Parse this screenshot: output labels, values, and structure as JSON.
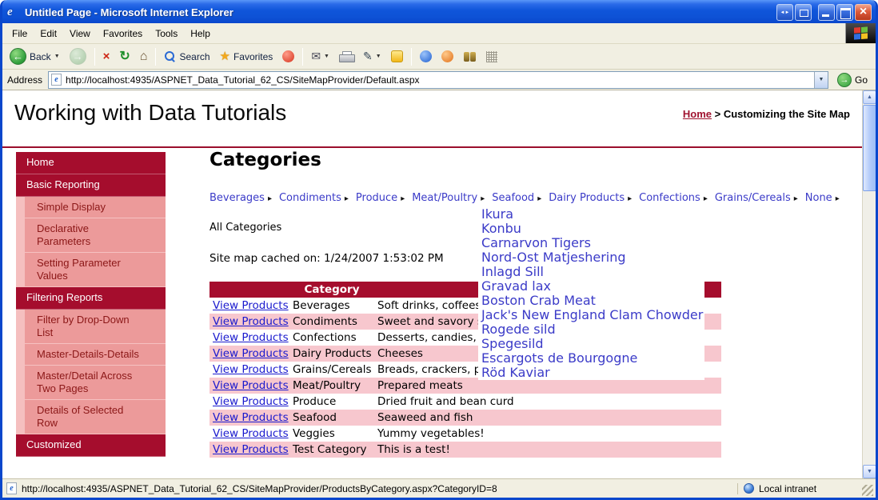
{
  "titlebar": {
    "title": "Untitled Page - Microsoft Internet Explorer"
  },
  "menubar": {
    "items": [
      "File",
      "Edit",
      "View",
      "Favorites",
      "Tools",
      "Help"
    ]
  },
  "toolbar": {
    "back": "Back",
    "search": "Search",
    "favorites": "Favorites"
  },
  "addressbar": {
    "label": "Address",
    "url": "http://localhost:4935/ASPNET_Data_Tutorial_62_CS/SiteMapProvider/Default.aspx",
    "go": "Go"
  },
  "header": {
    "title": "Working with Data Tutorials",
    "breadcrumb": {
      "home": "Home",
      "separator": " > ",
      "current": "Customizing the Site Map"
    }
  },
  "sidebar": {
    "items": [
      {
        "label": "Home"
      },
      {
        "label": "Basic Reporting"
      },
      {
        "label": "Simple Display"
      },
      {
        "label": "Declarative Parameters"
      },
      {
        "label": "Setting Parameter Values"
      },
      {
        "label": "Filtering Reports"
      },
      {
        "label": "Filter by Drop-Down List"
      },
      {
        "label": "Master-Details-Details"
      },
      {
        "label": "Master/Detail Across Two Pages"
      },
      {
        "label": "Details of Selected Row"
      },
      {
        "label": "Customized"
      }
    ]
  },
  "main": {
    "heading": "Categories",
    "menu": {
      "items": [
        "Beverages",
        "Condiments",
        "Produce",
        "Meat/Poultry",
        "Seafood",
        "Dairy Products",
        "Confections",
        "Grains/Cereals",
        "None"
      ]
    },
    "flyout": {
      "items": [
        "Ikura",
        "Konbu",
        "Carnarvon Tigers",
        "Nord-Ost Matjeshering",
        "Inlagd Sill",
        "Gravad lax",
        "Boston Crab Meat",
        "Jack's New England Clam Chowder",
        "Rogede sild",
        "Spegesild",
        "Escargots de Bourgogne",
        "Röd Kaviar"
      ]
    },
    "all_categories": "All Categories",
    "cache_note": "Site map cached on: 1/24/2007 1:53:02 PM",
    "table": {
      "category_header": "Category",
      "rows": [
        {
          "link": "View Products",
          "category": "Beverages",
          "description": "Soft drinks, coffees, teas, beers, and ales"
        },
        {
          "link": "View Products",
          "category": "Condiments",
          "description": "Sweet and savory sauces, relishes, spreads, and seasonings"
        },
        {
          "link": "View Products",
          "category": "Confections",
          "description": "Desserts, candies, and sweet breads"
        },
        {
          "link": "View Products",
          "category": "Dairy Products",
          "description": "Cheeses"
        },
        {
          "link": "View Products",
          "category": "Grains/Cereals",
          "description": "Breads, crackers, pasta, and cereal"
        },
        {
          "link": "View Products",
          "category": "Meat/Poultry",
          "description": "Prepared meats"
        },
        {
          "link": "View Products",
          "category": "Produce",
          "description": "Dried fruit and bean curd"
        },
        {
          "link": "View Products",
          "category": "Seafood",
          "description": "Seaweed and fish"
        },
        {
          "link": "View Products",
          "category": "Veggies",
          "description": "Yummy vegetables!"
        },
        {
          "link": "View Products",
          "category": "Test Category",
          "description": "This is a test!"
        }
      ]
    }
  },
  "statusbar": {
    "link_url": "http://localhost:4935/ASPNET_Data_Tutorial_62_CS/SiteMapProvider/ProductsByCategory.aspx?CategoryID=8",
    "zone": "Local intranet"
  },
  "colors": {
    "dark_red": "#a50d2d",
    "pink_item": "#ec9a9a",
    "pink_row": "#f7c7ce",
    "link_blue": "#1a1ace",
    "menu_blue": "#3b3bc8",
    "xp_title_blue": "#0f55da"
  }
}
